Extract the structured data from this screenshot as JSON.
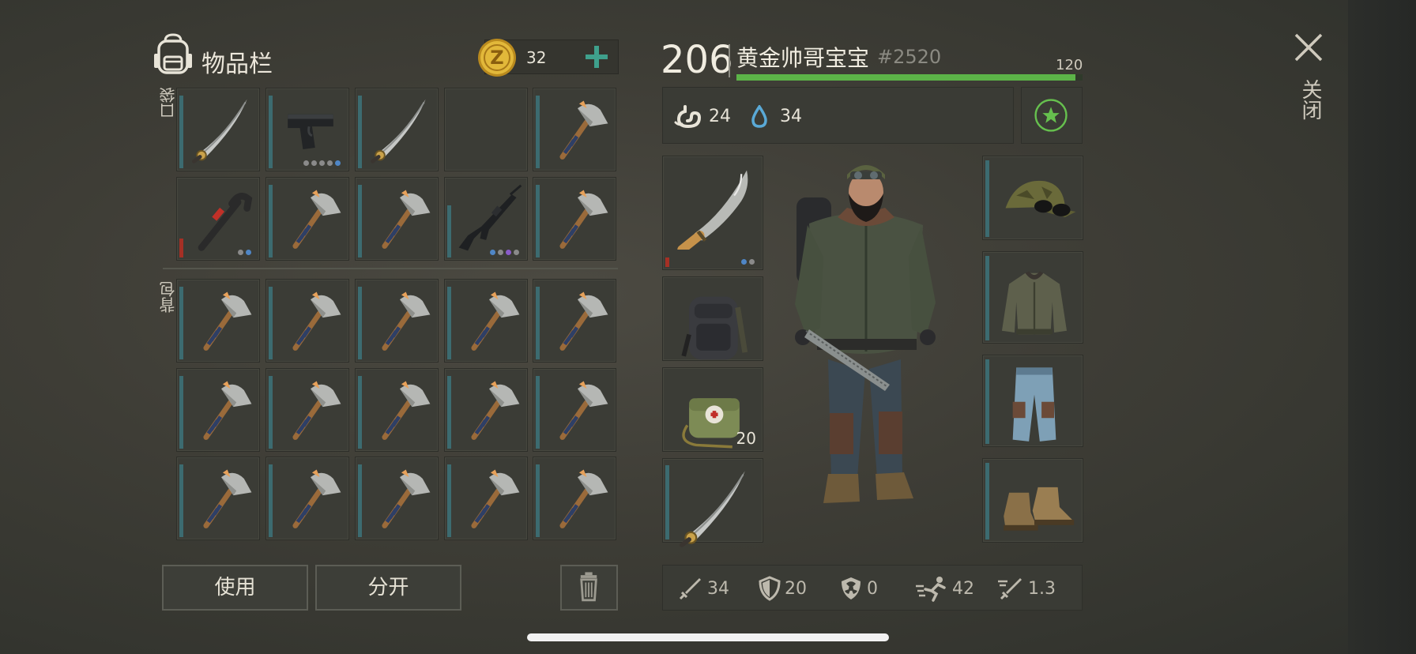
{
  "inventory": {
    "title": "物品栏",
    "icon": "backpack-icon",
    "coins": "32",
    "pocket_label": "口袋",
    "backpack_label": "背包"
  },
  "pocket_slots": [
    {
      "item": "katana-sword",
      "dots": []
    },
    {
      "item": "pistol",
      "dots": [
        "#8a8a8a",
        "#8a8a8a",
        "#8a8a8a",
        "#8a8a8a",
        "#4f86c6"
      ]
    },
    {
      "item": "katana-sword",
      "dots": []
    },
    {
      "item": "empty",
      "dots": []
    },
    {
      "item": "crude-axe",
      "dots": []
    },
    {
      "item": "crowbar",
      "dots": [
        "#8a8a8a",
        "#4f86c6"
      ]
    },
    {
      "item": "crude-axe",
      "dots": []
    },
    {
      "item": "crude-axe",
      "dots": []
    },
    {
      "item": "assault-rifle",
      "dots": [
        "#4f86c6",
        "#8a8a8a",
        "#8a5cc9",
        "#8a8a8a"
      ]
    },
    {
      "item": "crude-axe",
      "dots": []
    }
  ],
  "backpack_slots": [
    "crude-axe",
    "crude-axe",
    "crude-axe",
    "crude-axe",
    "crude-axe",
    "crude-axe",
    "crude-axe",
    "crude-axe",
    "crude-axe",
    "crude-axe",
    "crude-axe",
    "crude-axe",
    "crude-axe",
    "crude-axe",
    "crude-axe"
  ],
  "buttons": {
    "use": "使用",
    "split": "分开",
    "delete_icon": "trash-icon"
  },
  "player": {
    "level": "206",
    "name": "黄金帅哥宝宝",
    "tag": "#2520",
    "hp_max": "120",
    "hp_fraction": 0.98,
    "hunger": "24",
    "thirst": "34"
  },
  "equipment": {
    "left": [
      {
        "item": "machete",
        "dots": [
          "#4f86c6",
          "#8a8a8a"
        ]
      },
      {
        "item": "tactical-backpack"
      },
      {
        "item": "medical-bag",
        "count": "20"
      },
      {
        "item": "katana-sword"
      }
    ],
    "right": [
      "camo-cap-with-sunglasses",
      "bomber-jacket",
      "cargo-pants",
      "leather-boots"
    ]
  },
  "stats": {
    "attack": "34",
    "defense": "20",
    "radiation": "0",
    "speed": "42",
    "attack_speed": "1.3"
  },
  "close": {
    "label": "关闭",
    "icon": "close-icon"
  },
  "colors": {
    "hp_bar": "#5cb448",
    "accent_teal": "#3c6b70",
    "plus_green": "#3fa08c",
    "favorite_green": "#66c04e"
  }
}
